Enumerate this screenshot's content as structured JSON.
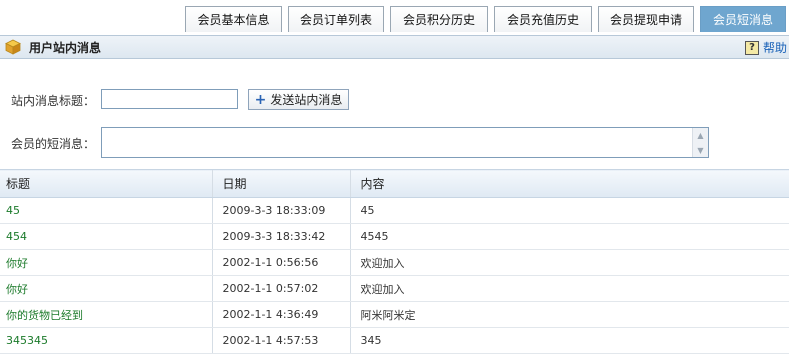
{
  "tabs": [
    {
      "label": "会员基本信息",
      "active": false
    },
    {
      "label": "会员订单列表",
      "active": false
    },
    {
      "label": "会员积分历史",
      "active": false
    },
    {
      "label": "会员充值历史",
      "active": false
    },
    {
      "label": "会员提现申请",
      "active": false
    },
    {
      "label": "会员短消息",
      "active": true
    }
  ],
  "header": {
    "title": "用户站内消息",
    "icon": "box-icon",
    "help_label": "帮助",
    "help_icon": "help-icon"
  },
  "form": {
    "title_label": "站内消息标题：",
    "title_value": "",
    "send_label": "发送站内消息",
    "message_label": "会员的短消息：",
    "message_value": ""
  },
  "table": {
    "columns": [
      "标题",
      "日期",
      "内容"
    ],
    "rows": [
      {
        "title": "45",
        "date": "2009-3-3 18:33:09",
        "content": "45"
      },
      {
        "title": "454",
        "date": "2009-3-3 18:33:42",
        "content": "4545"
      },
      {
        "title": "你好",
        "date": "2002-1-1 0:56:56",
        "content": "欢迎加入"
      },
      {
        "title": "你好",
        "date": "2002-1-1 0:57:02",
        "content": "欢迎加入"
      },
      {
        "title": "你的货物已经到",
        "date": "2002-1-1 4:36:49",
        "content": "阿米阿米定"
      },
      {
        "title": "345345",
        "date": "2002-1-1 4:57:53",
        "content": "345"
      }
    ]
  },
  "colors": {
    "active_tab": "#6fa6cf",
    "link_green": "#1b7a2a",
    "help_blue": "#1a62b8"
  }
}
